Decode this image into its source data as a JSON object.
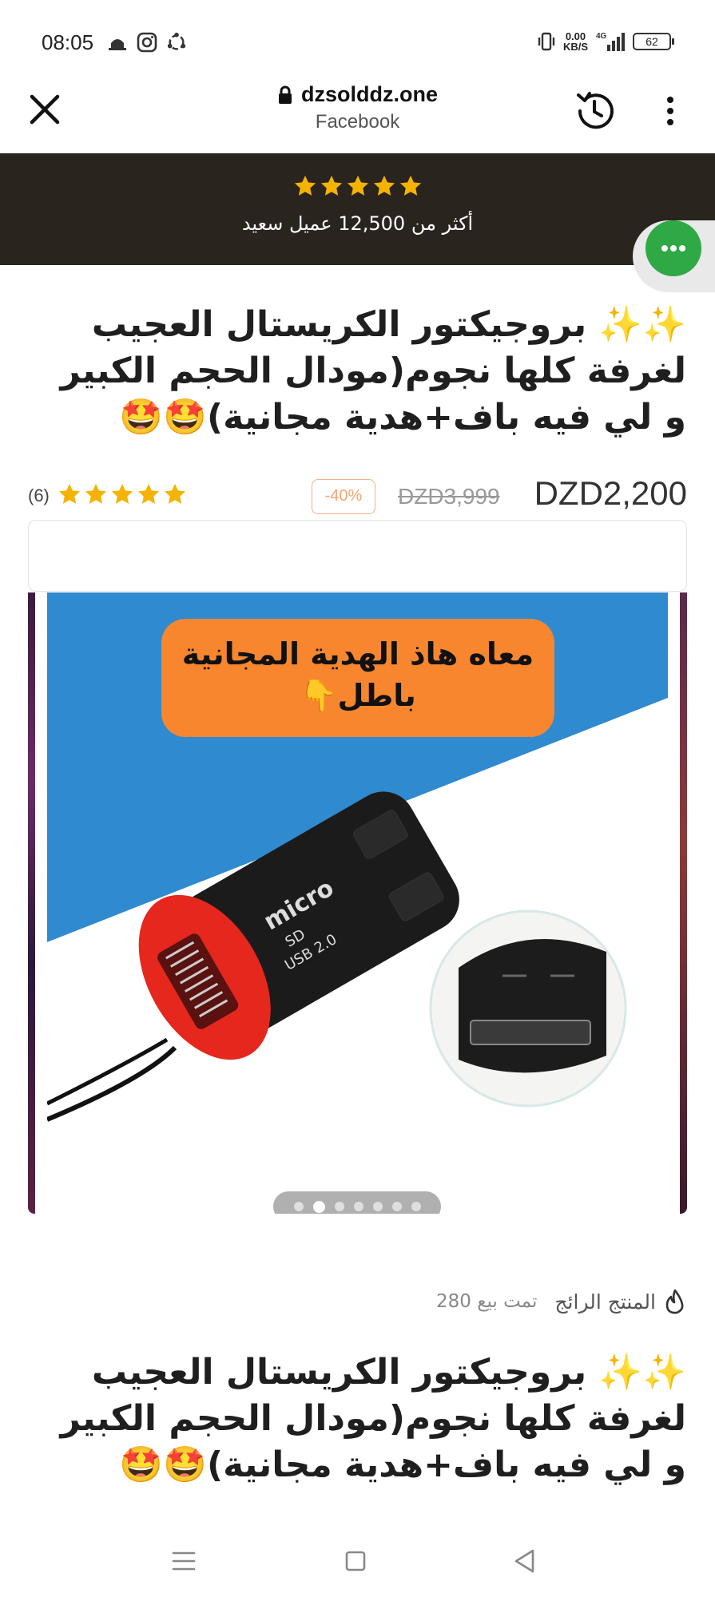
{
  "status_bar": {
    "time": "08:05",
    "notification_icons": [
      "mosque-icon",
      "instagram-icon",
      "sync-icon"
    ],
    "net_speed_value": "0.00",
    "net_speed_unit": "KB/S",
    "network": "4G",
    "battery": "62"
  },
  "browser": {
    "domain": "dzsolddz.one",
    "source": "Facebook",
    "icons": [
      "close-icon",
      "lock-icon",
      "history-icon",
      "more-vert-icon"
    ]
  },
  "banner": {
    "star_count": 5,
    "star_color": "#f5b301",
    "text": "أكثر من 12,500 عميل سعيد",
    "background": "#2a241f"
  },
  "chat_button": {
    "icon": "chat-icon",
    "color": "#2fa846"
  },
  "product": {
    "title_lines": [
      "✨✨ بروجيكتور الكريستال العجيب",
      "لغرفة كلها نجوم(مودال الحجم الكبير",
      "و لي فيه باف+هدية مجانية)🤩🤩"
    ],
    "price": "DZD2,200",
    "old_price": "DZD3,999",
    "discount": "-40%",
    "rating": 5,
    "rating_count": "(6)",
    "image": {
      "promo_lines": [
        "معاه هاذ الهدية المجانية",
        "باطل👇"
      ],
      "device_text": [
        "micro",
        "SD",
        "USB 2.0"
      ],
      "description": "micro SD card reader"
    },
    "slider": {
      "total": 7,
      "active_index": 1
    },
    "best_seller_label": "المنتج الرائج",
    "sold_text": "تمت بيع 280"
  },
  "nav_bar": {
    "icons": [
      "menu-icon",
      "home-icon",
      "back-icon"
    ]
  }
}
